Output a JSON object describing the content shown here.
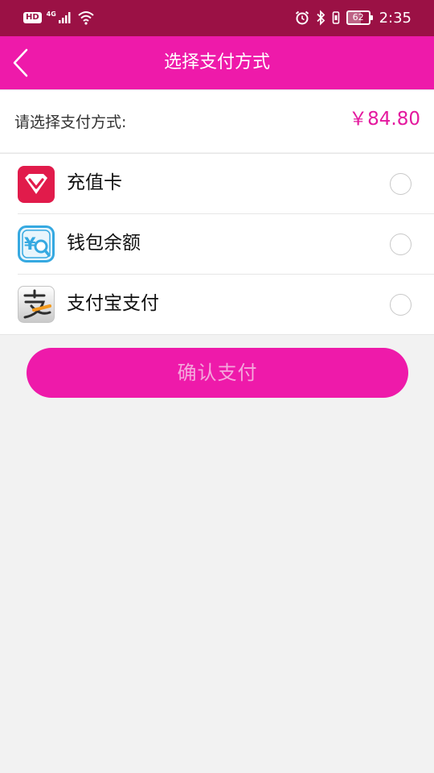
{
  "status_bar": {
    "hd_label": "HD",
    "network_label": "4G",
    "battery_level": "62",
    "time": "2:35",
    "icons": [
      "hd-icon",
      "signal-icon",
      "wifi-icon",
      "alarm-icon",
      "bluetooth-icon",
      "vibrate-icon",
      "battery-icon"
    ]
  },
  "header": {
    "title": "选择支付方式",
    "back_icon": "back-arrow-icon",
    "background": "#ee1aaa"
  },
  "amount": {
    "label": "请选择支付方式:",
    "value": "￥84.80",
    "color": "#e4189e"
  },
  "payment_methods": [
    {
      "label": "充值卡",
      "icon": "recharge-card-icon",
      "selected": false
    },
    {
      "label": "钱包余额",
      "icon": "wallet-balance-icon",
      "selected": false
    },
    {
      "label": "支付宝支付",
      "icon": "alipay-icon",
      "selected": false
    }
  ],
  "confirm_button": {
    "label": "确认支付"
  },
  "colors": {
    "status_bar": "#9b1145",
    "accent": "#ee1aaa",
    "page_background": "#f2f2f2"
  }
}
